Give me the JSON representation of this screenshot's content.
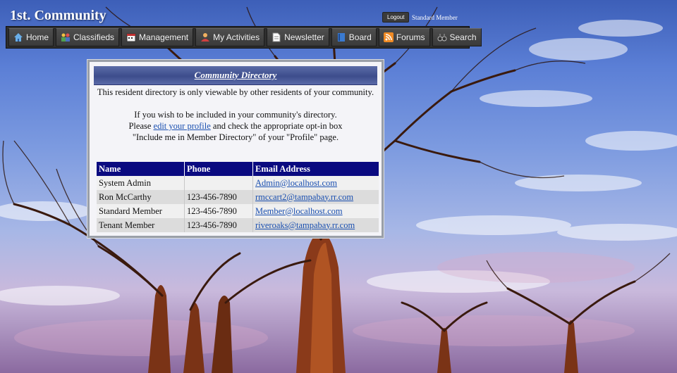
{
  "site": {
    "title": "1st. Community"
  },
  "account": {
    "logout_label": "Logout",
    "user_label": "Standard Member"
  },
  "nav": {
    "items": [
      {
        "label": "Home",
        "icon": "home-icon"
      },
      {
        "label": "Classifieds",
        "icon": "people-icon"
      },
      {
        "label": "Management",
        "icon": "calendar-icon"
      },
      {
        "label": "My Activities",
        "icon": "user-activities-icon"
      },
      {
        "label": "Newsletter",
        "icon": "document-icon"
      },
      {
        "label": "Board",
        "icon": "book-icon"
      },
      {
        "label": "Forums",
        "icon": "rss-icon"
      },
      {
        "label": "Search",
        "icon": "binoculars-icon"
      }
    ]
  },
  "directory": {
    "title": "Community Directory",
    "intro": "This resident directory is only viewable by other residents of your community.",
    "line1": "If you wish to be included in your community's directory.",
    "line2_pre": "Please ",
    "line2_link": "edit your profile",
    "line2_post": "  and check the appropriate opt-in box",
    "line3": "\"Include me in Member Directory\" of your \"Profile\" page.",
    "columns": [
      "Name",
      "Phone",
      "Email Address"
    ],
    "rows": [
      {
        "name": "System Admin",
        "phone": "",
        "email": "Admin@localhost.com"
      },
      {
        "name": "Ron McCarthy",
        "phone": "123-456-7890",
        "email": "rmccart2@tampabay.rr.com"
      },
      {
        "name": "Standard Member",
        "phone": "123-456-7890",
        "email": "Member@localhost.com"
      },
      {
        "name": "Tenant Member",
        "phone": "123-456-7890",
        "email": "riveroaks@tampabay.rr.com"
      }
    ]
  },
  "colors": {
    "table_header": "#0a0a80",
    "link": "#1a4fb0",
    "navbar": "#2e2e2e"
  }
}
